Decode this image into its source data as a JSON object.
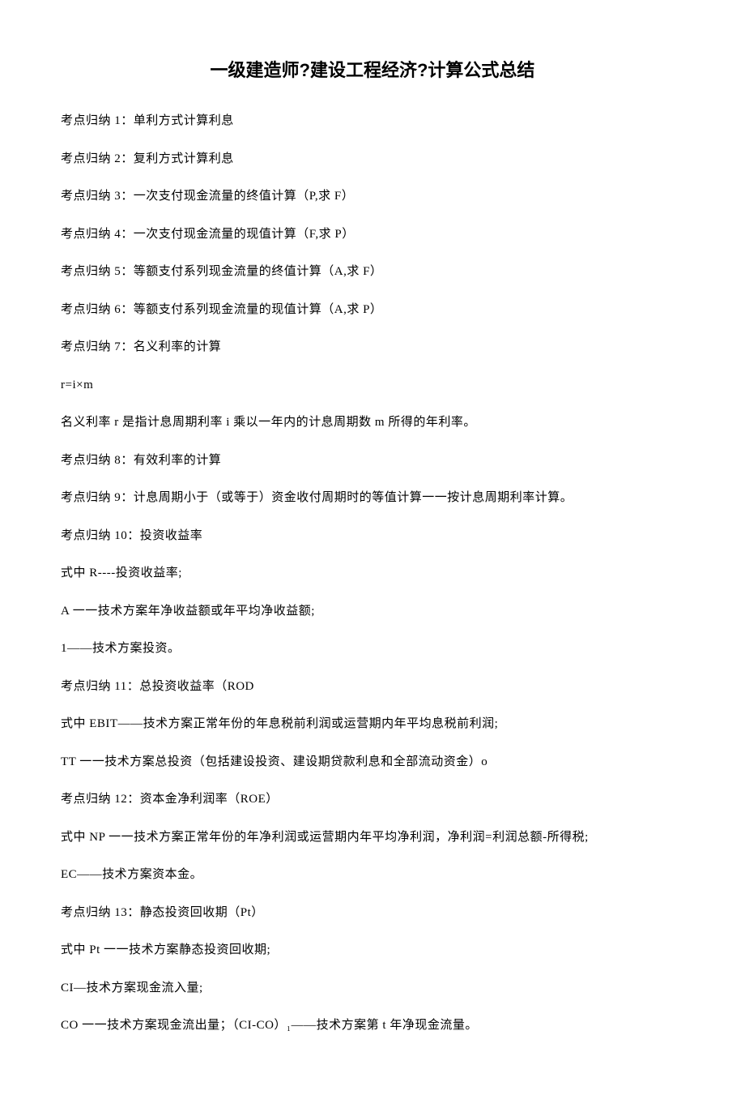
{
  "title": "一级建造师?建设工程经济?计算公式总结",
  "lines": [
    "考点归纳 1：单利方式计算利息",
    "考点归纳 2：复利方式计算利息",
    "考点归纳 3：一次支付现金流量的终值计算（P,求 F）",
    "考点归纳 4：一次支付现金流量的现值计算（F,求 P）",
    "考点归纳 5：等额支付系列现金流量的终值计算（A,求 F）",
    "考点归纳 6：等额支付系列现金流量的现值计算（A,求 P）",
    "考点归纳 7：名义利率的计算",
    "r=i×m",
    "名义利率 r 是指计息周期利率 i 乘以一年内的计息周期数 m 所得的年利率。",
    "考点归纳 8：有效利率的计算",
    "考点归纳 9：计息周期小于（或等于）资金收付周期时的等值计算一一按计息周期利率计算。",
    "考点归纳 10：投资收益率",
    "式中 R----投资收益率;",
    "A 一一技术方案年净收益额或年平均净收益额;",
    "1——技术方案投资。",
    "考点归纳 11：总投资收益率（ROD",
    "式中 EBIT——技术方案正常年份的年息税前利润或运营期内年平均息税前利润;",
    "TT 一一技术方案总投资（包括建设投资、建设期贷款利息和全部流动资金）o",
    "考点归纳 12：资本金净利润率（ROE）",
    "式中 NP 一一技术方案正常年份的年净利润或运营期内年平均净利润，净利润=利润总额-所得税;",
    "EC——技术方案资本金。",
    "考点归纳 13：静态投资回收期（Pt）",
    "式中 Pt 一一技术方案静态投资回收期;",
    "CI—技术方案现金流入量;",
    "CO 一一技术方案现金流出量；（CI-CO）₁——技术方案第 t 年净现金流量。"
  ]
}
